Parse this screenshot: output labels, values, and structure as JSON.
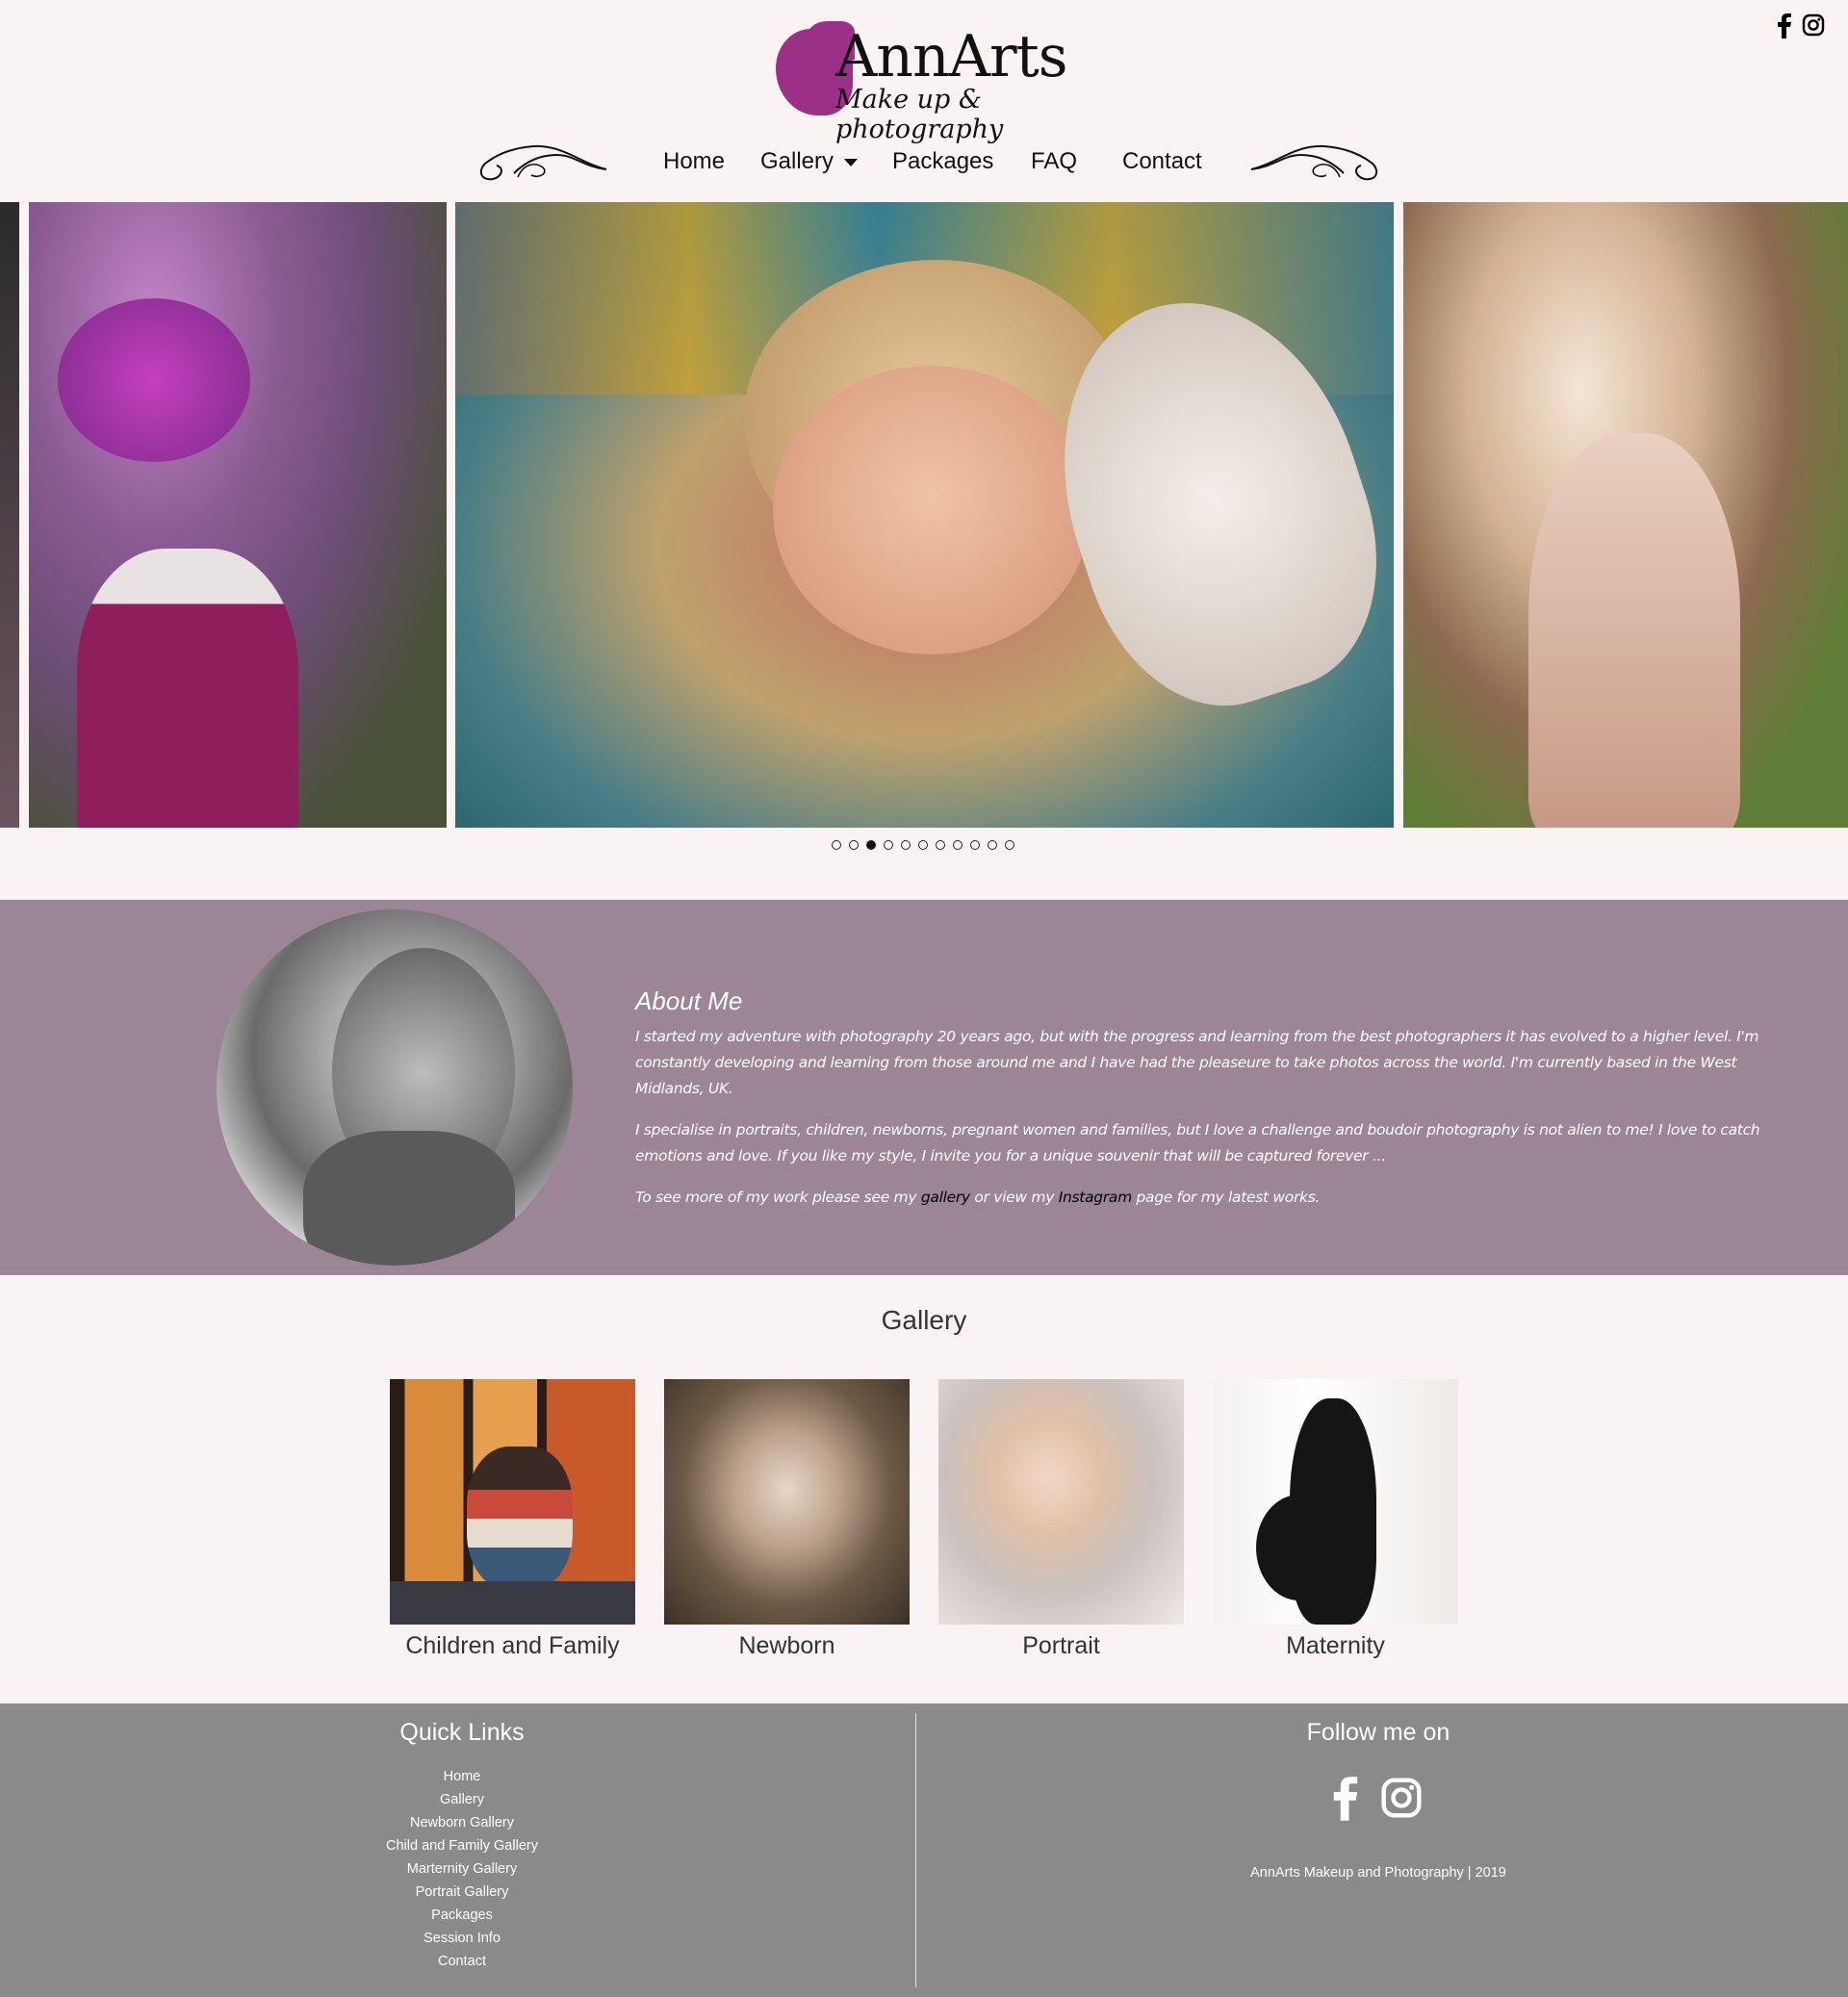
{
  "header": {
    "logo": {
      "brand": "AnnArts",
      "tagline": "Make up & photography"
    },
    "social": [
      "facebook-icon",
      "instagram-icon"
    ],
    "nav": [
      {
        "label": "Home"
      },
      {
        "label": "Gallery"
      },
      {
        "label": "Packages"
      },
      {
        "label": "FAQ"
      },
      {
        "label": "Contact"
      }
    ]
  },
  "carousel": {
    "slide_count": 11,
    "active_index": 2
  },
  "about": {
    "title": "About Me",
    "p1": "I started my adventure with photography 20 years ago, but with the progress and learning from the best photographers it has evolved to a higher level. I'm constantly developing and learning from those around me and I have had the pleaseure to take photos across the world. I'm currently based in the West Midlands, UK.",
    "p2": "I specialise in portraits, children, newborns, pregnant women and families, but I love a challenge and boudoir photography is not alien to me! I love to catch emotions and love. If you like my style, I invite you for a unique souvenir that will be captured forever ...",
    "p3_before": "To see more of my work please see my ",
    "p3_link1": "gallery",
    "p3_mid": " or view my ",
    "p3_link2": "Instagram",
    "p3_after": " page for my latest works."
  },
  "gallery": {
    "title": "Gallery",
    "items": [
      {
        "label": "Children and Family"
      },
      {
        "label": "Newborn"
      },
      {
        "label": "Portrait"
      },
      {
        "label": "Maternity"
      }
    ]
  },
  "footer": {
    "quick_links_title": "Quick Links",
    "links": [
      "Home",
      "Gallery",
      "Newborn Gallery",
      "Child and Family Gallery",
      "Marternity Gallery",
      "Portrait Gallery",
      "Packages",
      "Session Info",
      "Contact"
    ],
    "follow_title": "Follow me on",
    "copyright": "AnnArts Makeup and Photography | 2019"
  },
  "colors": {
    "background": "#f9f3f3",
    "logo_accent": "#9c2f86",
    "about_band": "#9c8695",
    "footer": "#8a8a8a"
  }
}
